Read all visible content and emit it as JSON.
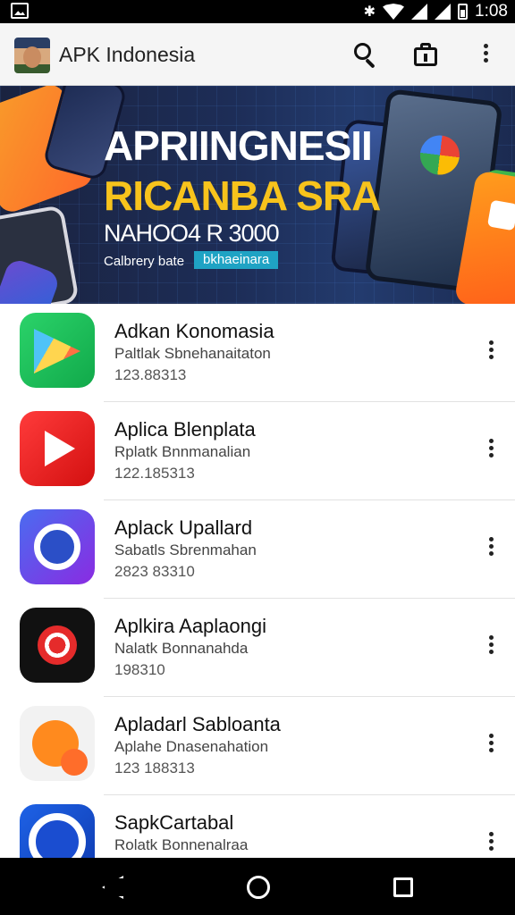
{
  "status_bar": {
    "time": "1:08",
    "icons": [
      "gallery-icon",
      "bluetooth-icon",
      "wifi-icon",
      "signal-icon",
      "battery-icon"
    ]
  },
  "app_bar": {
    "title": "APK Indonesia",
    "actions": [
      "search-icon",
      "store-icon",
      "more-vert-icon"
    ]
  },
  "banner": {
    "line1": "APRIINGNESII",
    "line2": "RICANBA SRA",
    "line3": "NAHOO4 R 3000",
    "line4": "Calbrery bate",
    "line5": "bkhaeinara",
    "accent_colors": [
      "#f7c31c",
      "#1fa3c4"
    ]
  },
  "apps": [
    {
      "name": "Adkan Konomasia",
      "subtitle": "Paltlak Sbnehanaitaton",
      "number": "123.88313",
      "icon": "play-triangle-icon"
    },
    {
      "name": "Aplica Blenplata",
      "subtitle": "Rplatk Bnnmanalian",
      "number": "122.185313",
      "icon": "video-play-icon"
    },
    {
      "name": "Aplack Upallard",
      "subtitle": "Sabatls Sbrenmahan",
      "number": "2823 83310",
      "icon": "ring-icon"
    },
    {
      "name": "Aplkira Aaplaongi",
      "subtitle": "Nalatk Bonnanahda",
      "number": "198310",
      "icon": "target-icon"
    },
    {
      "name": "Apladarl Sabloanta",
      "subtitle": "Aplahe Dnasenahation",
      "number": "123 188313",
      "icon": "fruit-character-icon"
    },
    {
      "name": "SapkCartabal",
      "subtitle": "Rolatk Bonnenalraa",
      "number": "",
      "icon": "disc-icon"
    }
  ],
  "nav_bar": {
    "buttons": [
      "back-icon",
      "home-icon",
      "recents-icon"
    ]
  }
}
